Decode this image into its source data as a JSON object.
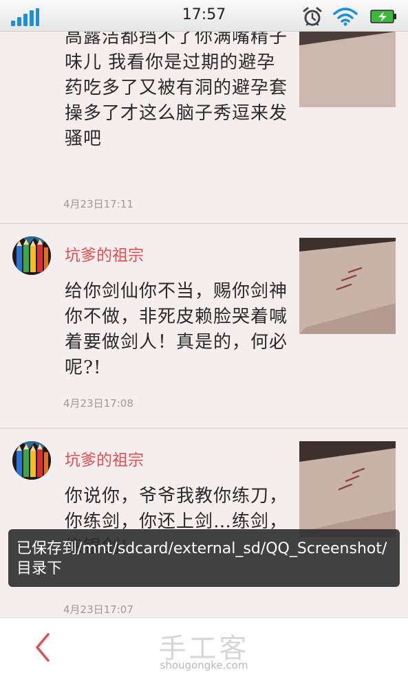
{
  "status_bar": {
    "time": "17:57",
    "signal_icon": "signal-bars-icon",
    "alarm_icon": "alarm-clock-icon",
    "wifi_icon": "wifi-icon",
    "battery_icon": "battery-charging-icon"
  },
  "posts": [
    {
      "body": "高露洁都挡不了你满嘴精子味儿 我看你是过期的避孕药吃多了又被有洞的避孕套操多了才这么脑子秀逗来发骚吧",
      "time": "4月23日17:11"
    },
    {
      "username": "坑爹的祖宗",
      "body": "给你剑仙你不当，赐你剑神你不做，非死皮赖脸哭着喊着要做剑人！真是的，何必呢?!",
      "time": "4月23日17:08"
    },
    {
      "username": "坑爹的祖宗",
      "body": "你说你，爷爷我教你练刀，你练剑，你还上剑…练剑，练银剑!",
      "time": "4月23日17:07"
    }
  ],
  "toast": {
    "message": "已保存到/mnt/sdcard/external_sd/QQ_Screenshot/目录下"
  },
  "bottom_bar": {
    "back_icon": "chevron-left-icon",
    "watermark_title": "手工客",
    "watermark_url": "shougongke.com"
  },
  "colors": {
    "accent": "#e05050",
    "background": "#f5eeee",
    "signal": "#1e90d8",
    "battery": "#3cb83c"
  }
}
